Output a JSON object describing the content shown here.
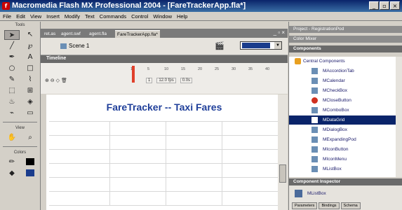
{
  "window": {
    "title": "Macromedia Flash MX Professional 2004 - [FareTrackerApp.fla*]",
    "min_label": "_",
    "max_label": "▫",
    "close_label": "×"
  },
  "menu": [
    "File",
    "Edit",
    "View",
    "Insert",
    "Modify",
    "Text",
    "Commands",
    "Control",
    "Window",
    "Help"
  ],
  "tools": {
    "header": "Tools",
    "view_label": "View",
    "colors_label": "Colors"
  },
  "document": {
    "tabs": [
      "ret.as",
      "agent.swf",
      "agent.fla",
      "FareTrackerApp.fla*"
    ],
    "scene": "Scene 1",
    "timeline_label": "Timeline",
    "frame_numbers": [
      "1",
      "5",
      "10",
      "15",
      "20",
      "25",
      "30",
      "35",
      "40"
    ],
    "status": {
      "frame": "1",
      "fps": "12.0 fps",
      "time": "0.0s"
    },
    "stage_title": "FareTracker -- Taxi Fares"
  },
  "panels": {
    "project_label": "Project - RegistrationPod",
    "color_mixer_label": "Color Mixer",
    "components_label": "Components",
    "component_group": "Central Components",
    "components": [
      "MAccordionTab",
      "MCalendar",
      "MCheckBox",
      "MCloseButton",
      "MComboBox",
      "MDataGrid",
      "MDialogBox",
      "MExpandingPod",
      "MIconButton",
      "MIconMenu",
      "MListBox"
    ],
    "selected_index": 5,
    "inspector_label": "Component Inspector",
    "inspector_item": "MListBox",
    "inspector_tabs": [
      "Parameters",
      "Bindings",
      "Schema"
    ]
  }
}
